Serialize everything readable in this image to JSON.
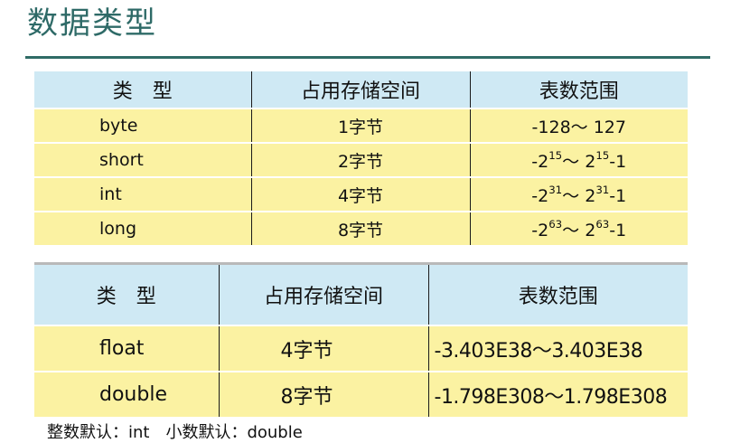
{
  "slide": {
    "title": "数据类型"
  },
  "table_integers": {
    "headers": [
      "类　型",
      "占用存储空间",
      "表数范围"
    ],
    "rows": [
      {
        "type": "byte",
        "size": "1字节",
        "range_html": "-128～ 127"
      },
      {
        "type": "short",
        "size": "2字节",
        "range_html": "-2<sup>15</sup>～ 2<sup>15</sup>-1"
      },
      {
        "type": "int",
        "size": "4字节",
        "range_html": "-2<sup>31</sup>～ 2<sup>31</sup>-1"
      },
      {
        "type": "long",
        "size": "8字节",
        "range_html": "-2<sup>63</sup>～ 2<sup>63</sup>-1"
      }
    ]
  },
  "table_floats": {
    "headers": [
      "类　型",
      "占用存储空间",
      "表数范围"
    ],
    "rows": [
      {
        "type": "float",
        "size": "4字节",
        "range": "-3.403E38～3.403E38"
      },
      {
        "type": "double",
        "size": "8字节",
        "range": "-1.798E308～1.798E308"
      }
    ]
  },
  "footnote": {
    "text": "整数默认：int　小数默认：double"
  },
  "colors": {
    "title": "#2e6a67",
    "header_bg": "#cfe9f4",
    "row_bg": "#fbf2a2"
  }
}
